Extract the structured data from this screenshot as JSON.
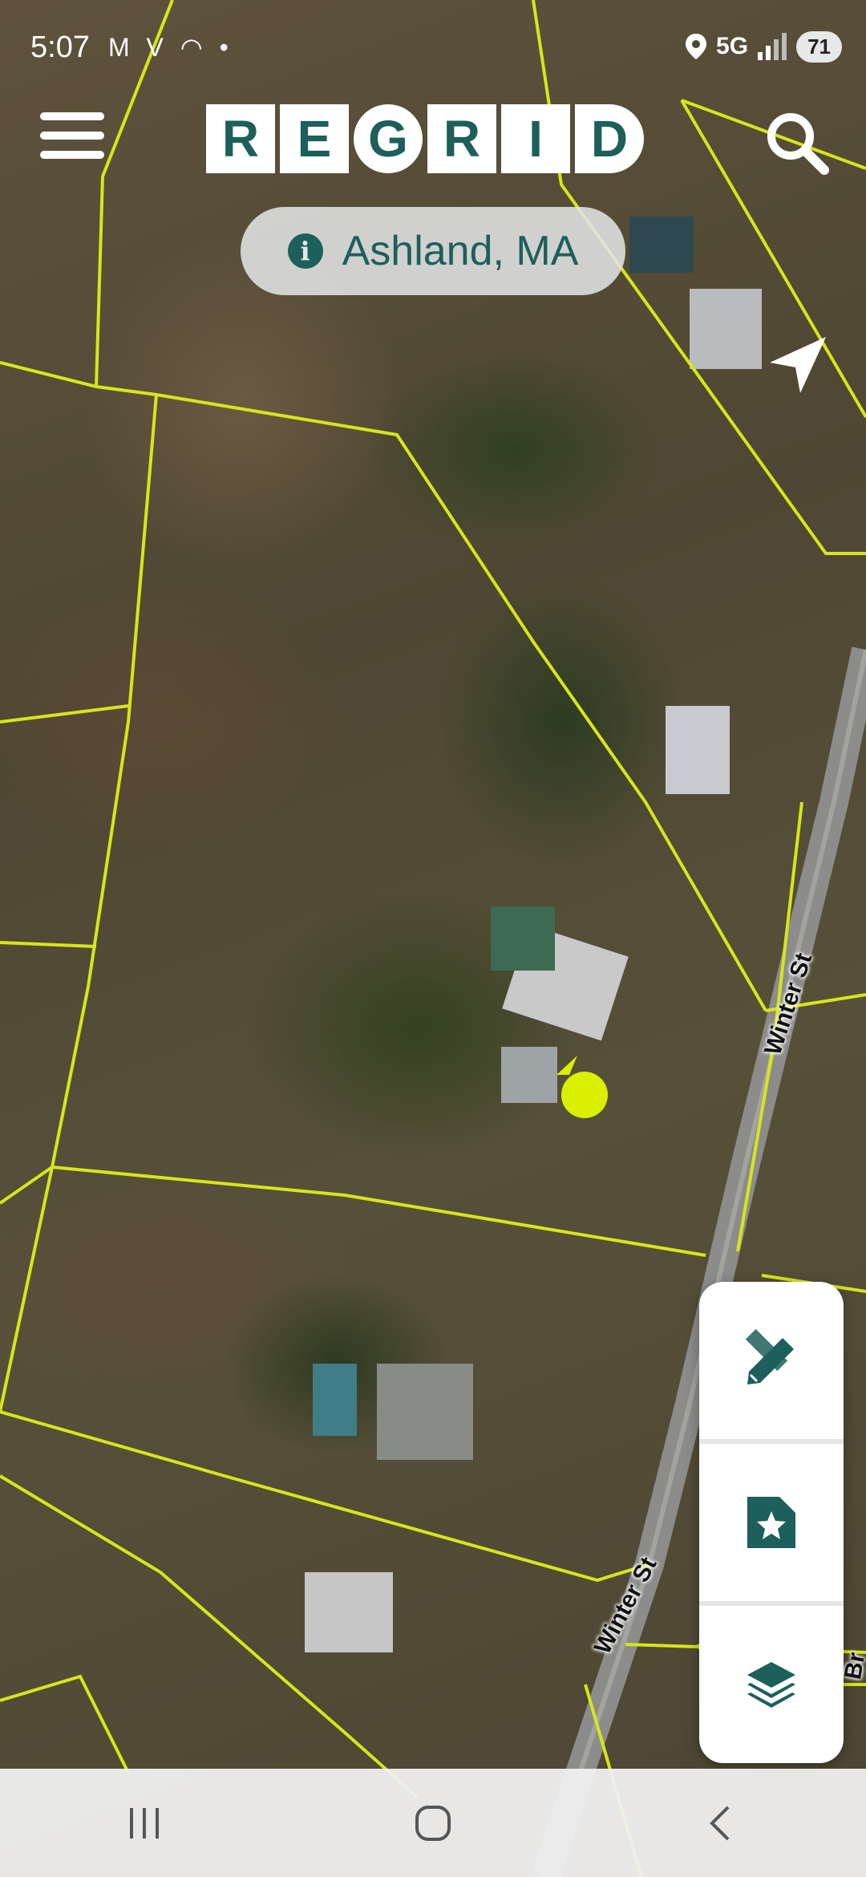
{
  "status_bar": {
    "time": "5:07",
    "left_icons": "M V ",
    "network": "5G",
    "battery": "71"
  },
  "header": {
    "logo_letters": [
      "R",
      "E",
      "G",
      "R",
      "I",
      "D"
    ],
    "location": "Ashland, MA"
  },
  "map": {
    "street_labels": [
      "Winter St",
      "Winter St",
      "Br"
    ],
    "parcel_line_color": "#d6e61a",
    "marker_color": "#d9f000"
  },
  "fab_panel": {
    "items": [
      "edit-tools-icon",
      "bookmark-star-icon",
      "layers-icon"
    ]
  },
  "nav_bar": {
    "items": [
      "recent-apps-icon",
      "home-icon",
      "back-icon"
    ]
  },
  "colors": {
    "brand": "#1d5f5a",
    "pill_bg": "#e1e4e4"
  }
}
